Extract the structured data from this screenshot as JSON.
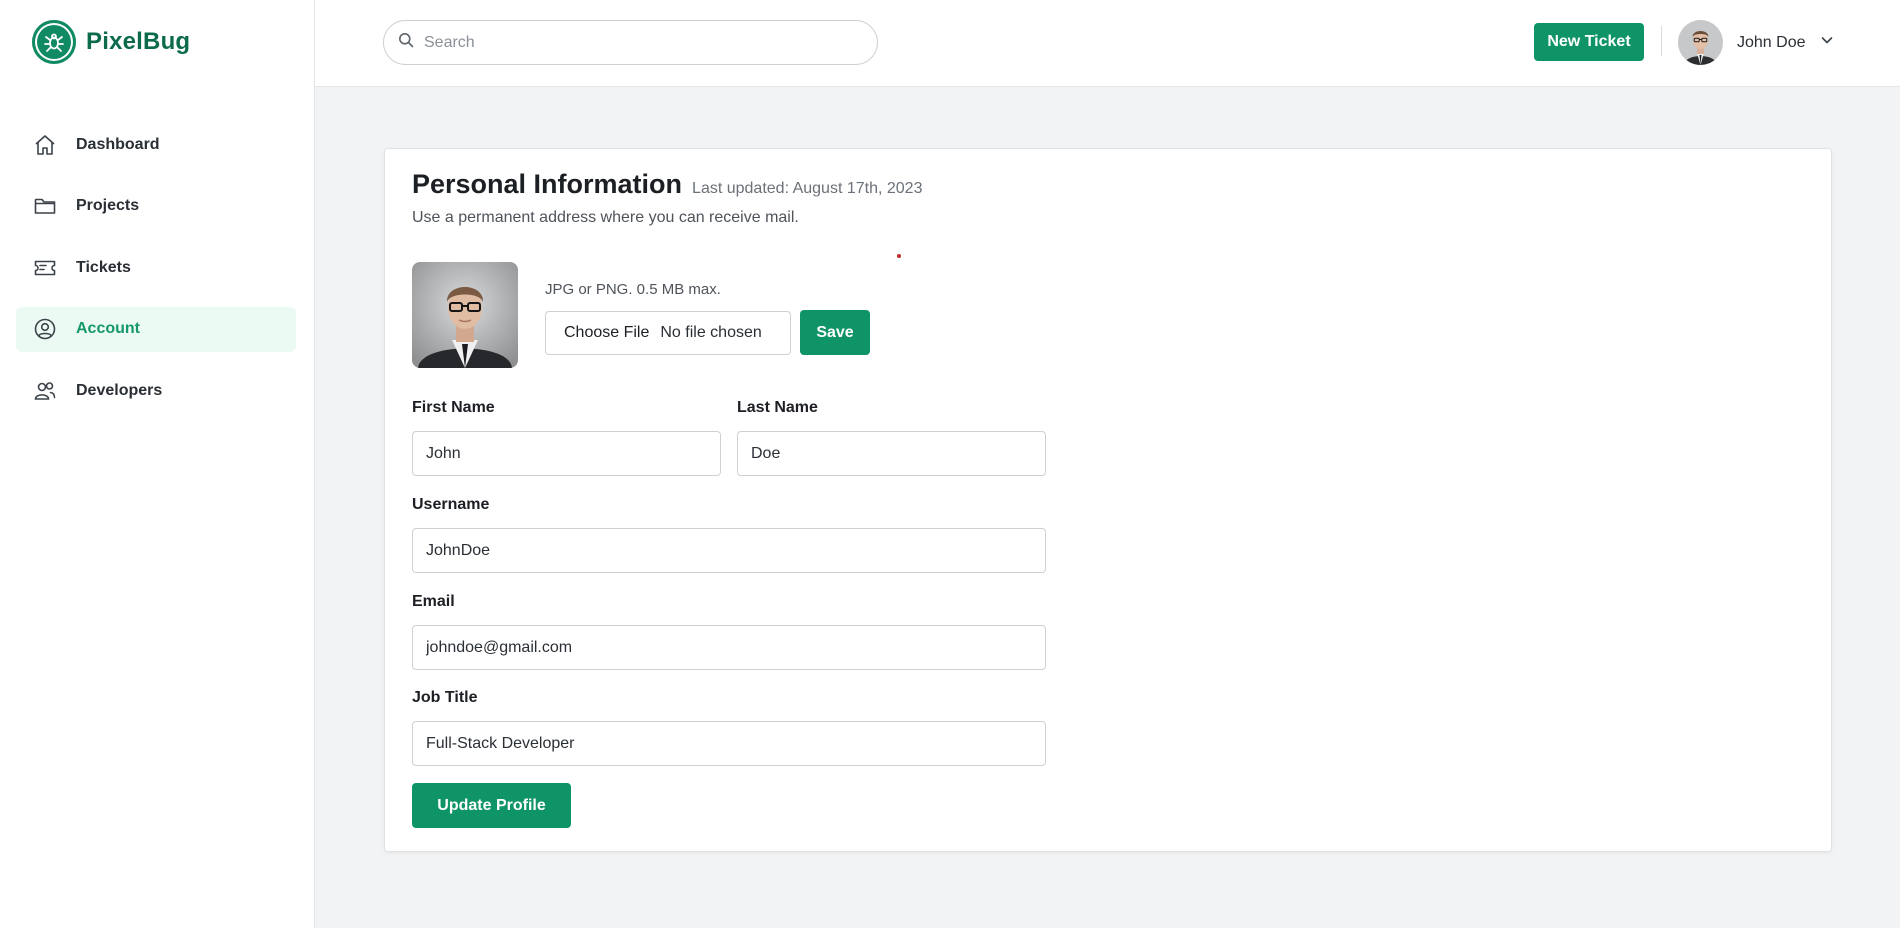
{
  "brand": {
    "name": "PixelBug",
    "logo_icon": "bug-icon",
    "color": "#0f8a63"
  },
  "sidebar": {
    "items": [
      {
        "label": "Dashboard",
        "icon": "home-icon",
        "active": false
      },
      {
        "label": "Projects",
        "icon": "folder-icon",
        "active": false
      },
      {
        "label": "Tickets",
        "icon": "ticket-icon",
        "active": false
      },
      {
        "label": "Account",
        "icon": "user-circle-icon",
        "active": true
      },
      {
        "label": "Developers",
        "icon": "users-icon",
        "active": false
      }
    ]
  },
  "header": {
    "search_placeholder": "Search",
    "new_ticket_label": "New Ticket",
    "user_name": "John Doe"
  },
  "profile": {
    "title": "Personal Information",
    "last_updated": "Last updated: August 17th, 2023",
    "subtitle": "Use a permanent address where you can receive mail.",
    "upload_hint": "JPG or PNG. 0.5 MB max.",
    "choose_file_label": "Choose File",
    "file_status": "No file chosen",
    "save_label": "Save",
    "fields": {
      "first_name": {
        "label": "First Name",
        "value": "John"
      },
      "last_name": {
        "label": "Last Name",
        "value": "Doe"
      },
      "username": {
        "label": "Username",
        "value": "JohnDoe"
      },
      "email": {
        "label": "Email",
        "value": "johndoe@gmail.com"
      },
      "job_title": {
        "label": "Job Title",
        "value": "Full-Stack Developer"
      }
    },
    "update_label": "Update Profile"
  },
  "colors": {
    "accent": "#0f9468",
    "active_bg": "#ebfaf2",
    "active_text": "#16976c",
    "page_bg": "#f2f3f4"
  }
}
